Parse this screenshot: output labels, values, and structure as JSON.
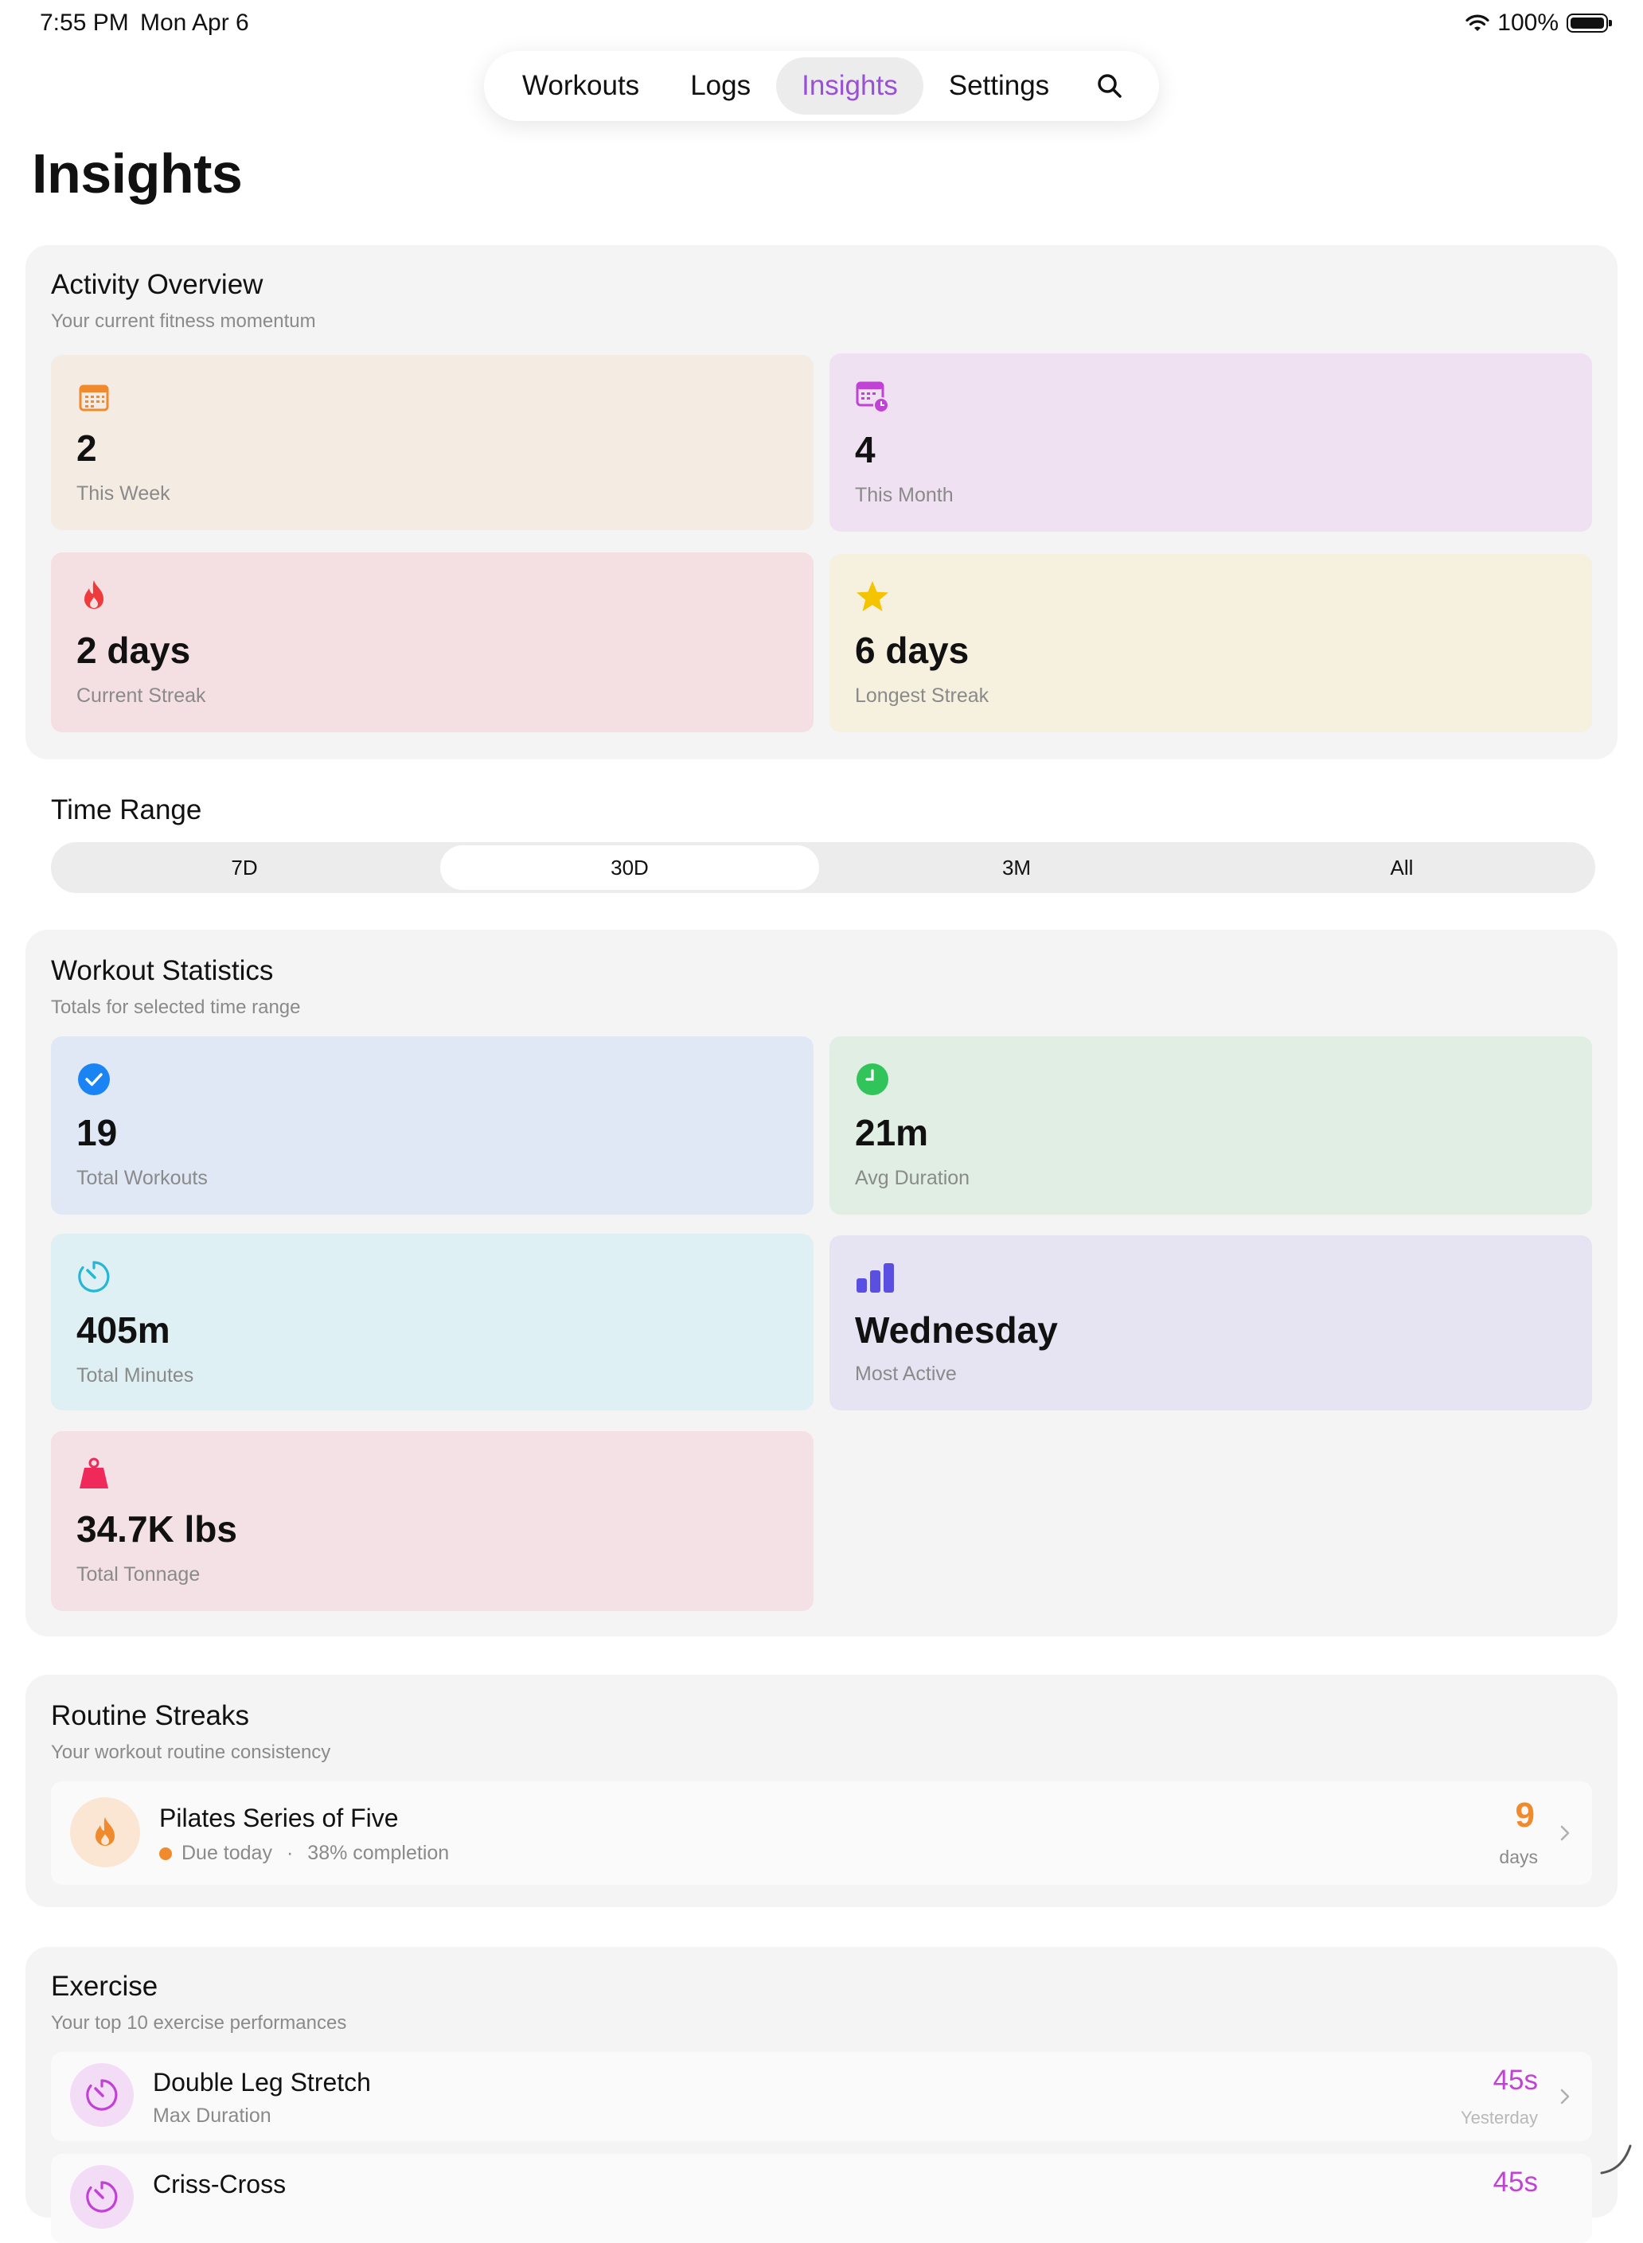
{
  "status_bar": {
    "time": "7:55 PM",
    "date": "Mon Apr 6",
    "battery": "100%",
    "battery_level": 1.0
  },
  "nav": {
    "tabs": [
      {
        "label": "Workouts",
        "active": false
      },
      {
        "label": "Logs",
        "active": false
      },
      {
        "label": "Insights",
        "active": true
      },
      {
        "label": "Settings",
        "active": false
      }
    ],
    "search_icon": "magnifyingglass",
    "active_color": "#9a4fd8"
  },
  "page_title": "Insights",
  "activity_overview": {
    "title": "Activity Overview",
    "subtitle": "Your current fitness momentum",
    "tiles": [
      {
        "value": "2",
        "label": "This Week",
        "icon": "calendar-icon",
        "color": "#f08a2c",
        "bg": "#f4ebe2"
      },
      {
        "value": "4",
        "label": "This Month",
        "icon": "calendar-clock-icon",
        "color": "#c043d6",
        "bg": "#f0e1f2"
      },
      {
        "value": "2 days",
        "label": "Current Streak",
        "icon": "flame-icon",
        "color": "#ef3b3b",
        "bg": "#f4e0e2"
      },
      {
        "value": "6 days",
        "label": "Longest Streak",
        "icon": "star-icon",
        "color": "#f5c400",
        "bg": "#f6f0df"
      }
    ]
  },
  "time_range": {
    "title": "Time Range",
    "options": [
      "7D",
      "30D",
      "3M",
      "All"
    ],
    "selected": "30D"
  },
  "workout_statistics": {
    "title": "Workout Statistics",
    "subtitle": "Totals for selected time range",
    "tiles": [
      {
        "value": "19",
        "label": "Total Workouts",
        "icon": "checkmark-circle-icon",
        "color": "#1a84f5",
        "bg": "#dfe8f4"
      },
      {
        "value": "21m",
        "label": "Avg Duration",
        "icon": "clock-icon",
        "color": "#31c45a",
        "bg": "#e1eee3"
      },
      {
        "value": "405m",
        "label": "Total Minutes",
        "icon": "timer-icon",
        "color": "#27b6d3",
        "bg": "#dff0f4"
      },
      {
        "value": "Wednesday",
        "label": "Most Active",
        "icon": "bar-chart-icon",
        "color": "#5a4fe0",
        "bg": "#e6e4f3"
      },
      {
        "value": "34.7K lbs",
        "label": "Total Tonnage",
        "icon": "scalemass-icon",
        "color": "#ef2a5a",
        "bg": "#f4e1e5"
      }
    ]
  },
  "routine_streaks": {
    "title": "Routine Streaks",
    "subtitle": "Your workout routine consistency",
    "items": [
      {
        "name": "Pilates Series of Five",
        "due": "Due today",
        "separator": "·",
        "completion": "38% completion",
        "count": "9",
        "unit": "days",
        "icon": "flame-icon",
        "accent": "#f08a2c"
      }
    ]
  },
  "exercise": {
    "title": "Exercise",
    "subtitle": "Your top 10 exercise performances",
    "items": [
      {
        "name": "Double Leg Stretch",
        "metric": "Max Duration",
        "value": "45s",
        "when": "Yesterday",
        "icon": "timer-icon",
        "accent": "#c043d6"
      },
      {
        "name": "Criss-Cross",
        "metric": "",
        "value": "45s",
        "when": "",
        "icon": "timer-icon",
        "accent": "#c043d6"
      }
    ]
  }
}
